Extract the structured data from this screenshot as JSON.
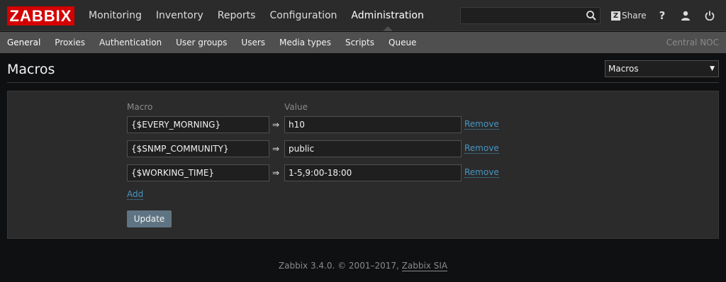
{
  "logo": "ZABBIX",
  "main_nav": [
    "Monitoring",
    "Inventory",
    "Reports",
    "Configuration",
    "Administration"
  ],
  "main_nav_selected": "Administration",
  "search": {
    "value": "",
    "placeholder": ""
  },
  "share_label": "Share",
  "help_label": "?",
  "sub_nav": [
    "General",
    "Proxies",
    "Authentication",
    "User groups",
    "Users",
    "Media types",
    "Scripts",
    "Queue"
  ],
  "sub_nav_selected": "General",
  "server_name": "Central NOC",
  "page": {
    "title": "Macros",
    "selector_value": "Macros"
  },
  "form": {
    "col_macro": "Macro",
    "col_value": "Value",
    "arrow": "⇒",
    "remove_label": "Remove",
    "add_label": "Add",
    "update_label": "Update",
    "rows": [
      {
        "macro": "{$EVERY_MORNING}",
        "value": "h10"
      },
      {
        "macro": "{$SNMP_COMMUNITY}",
        "value": "public"
      },
      {
        "macro": "{$WORKING_TIME}",
        "value": "1-5,9:00-18:00"
      }
    ]
  },
  "footer": {
    "text": "Zabbix 3.4.0. © 2001–2017,",
    "link": "Zabbix SIA"
  },
  "colors": {
    "logo_red": "#d40000",
    "link_blue": "#4796c4",
    "button": "#5f7483",
    "topbar": "#2b2b2b",
    "subbar": "#4f4f4f"
  },
  "icons": [
    "search-icon",
    "share-icon",
    "help-icon",
    "user-profile-icon",
    "logout-icon",
    "chevron-down-icon"
  ]
}
